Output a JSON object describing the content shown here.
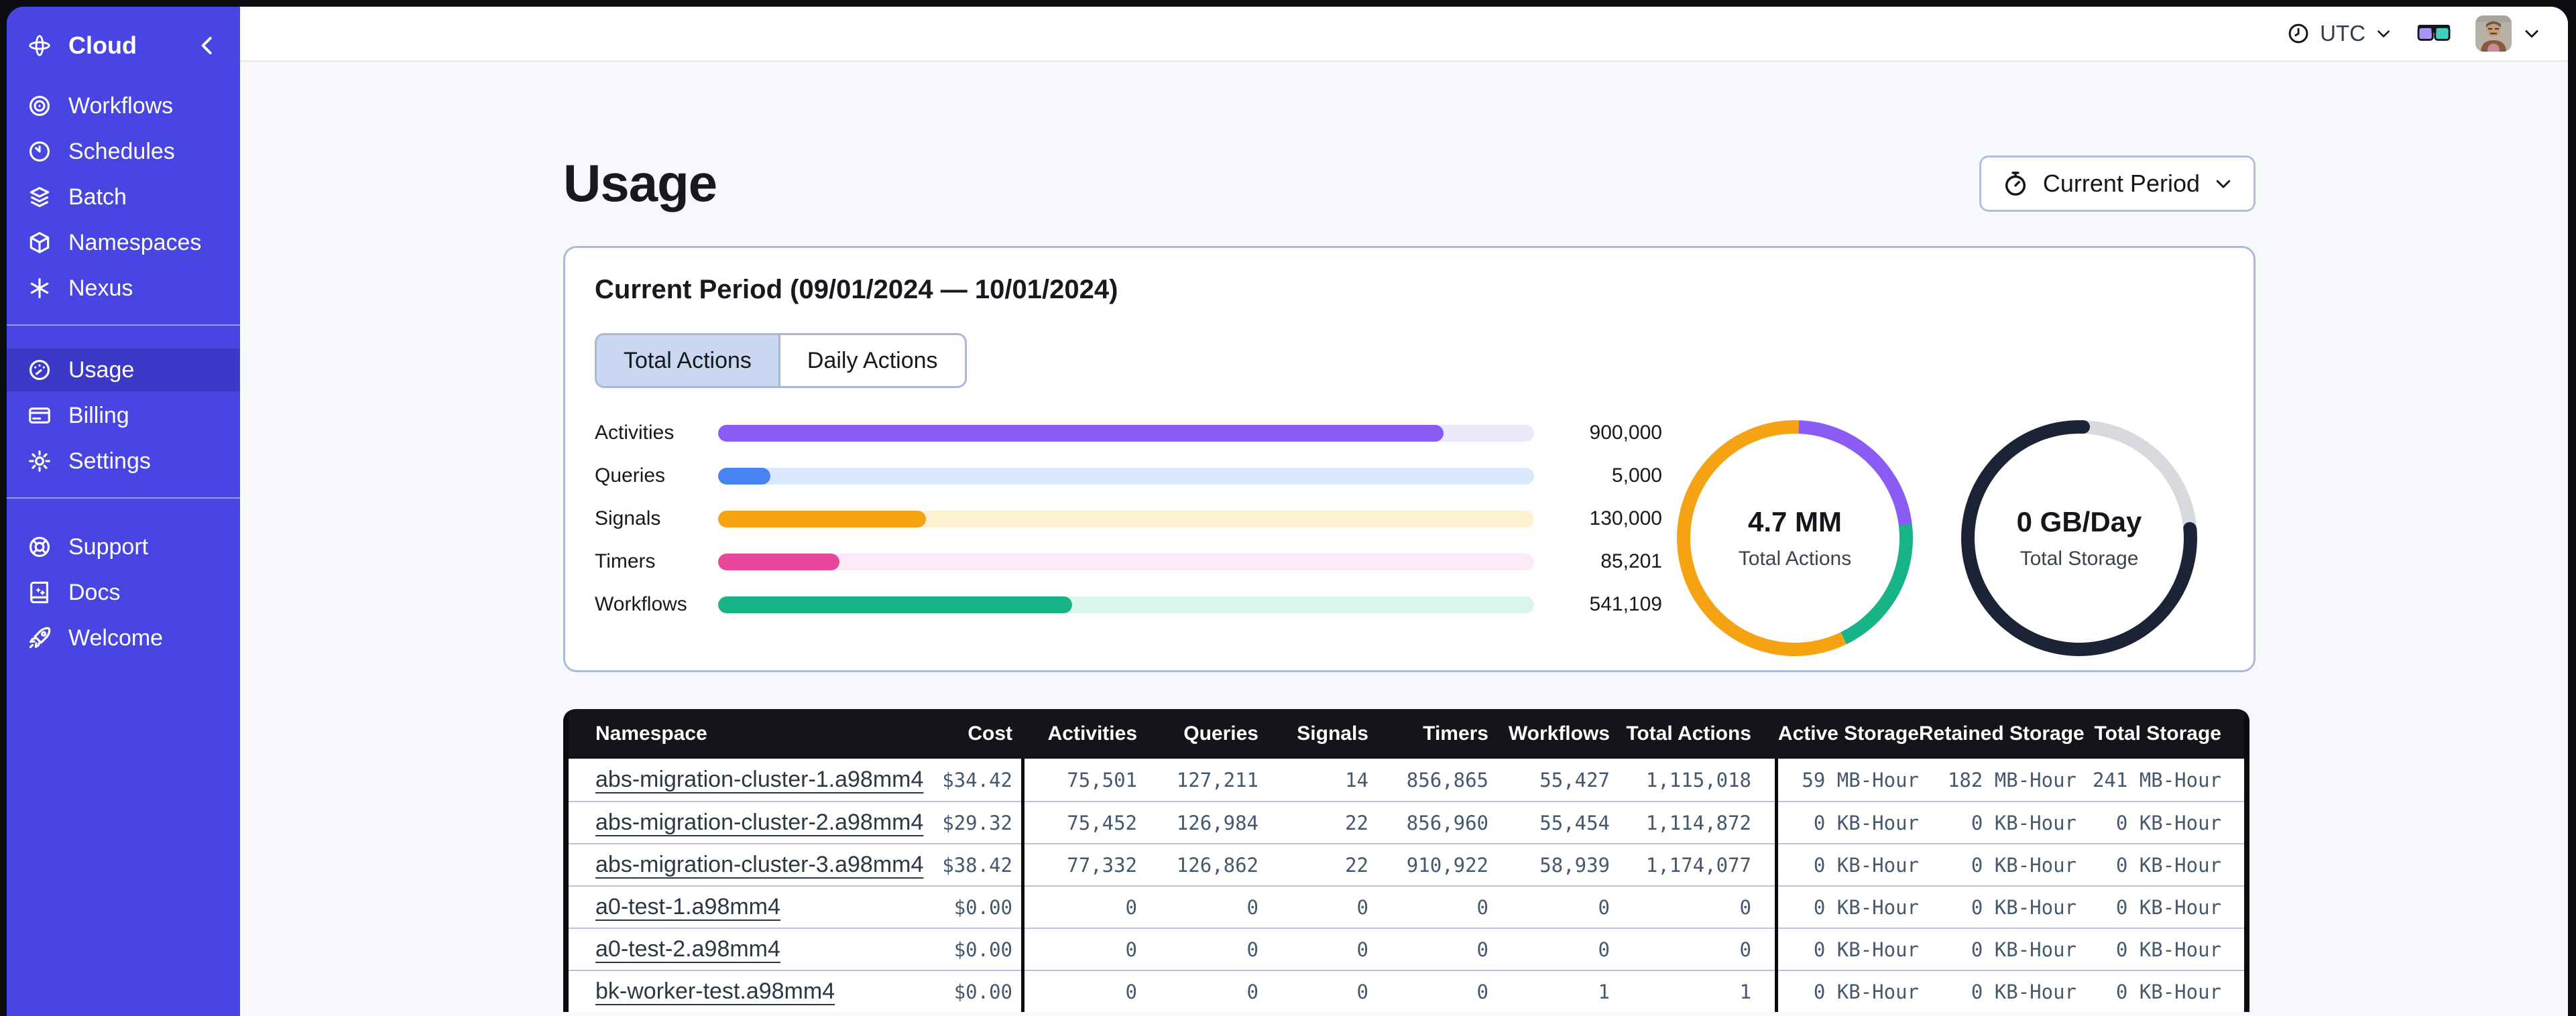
{
  "sidebar": {
    "brand": {
      "label": "Cloud"
    },
    "nav_main": [
      {
        "label": "Workflows"
      },
      {
        "label": "Schedules"
      },
      {
        "label": "Batch"
      },
      {
        "label": "Namespaces"
      },
      {
        "label": "Nexus"
      }
    ],
    "nav_account": [
      {
        "label": "Usage",
        "active": true
      },
      {
        "label": "Billing",
        "active": false
      },
      {
        "label": "Settings",
        "active": false
      }
    ],
    "nav_help": [
      {
        "label": "Support"
      },
      {
        "label": "Docs"
      },
      {
        "label": "Welcome"
      }
    ]
  },
  "topbar": {
    "timezone": "UTC"
  },
  "main": {
    "title": "Usage",
    "period_selector": {
      "label": "Current Period"
    },
    "card": {
      "title": "Current Period (09/01/2024 — 10/01/2024)",
      "tabs": [
        {
          "label": "Total Actions",
          "active": true
        },
        {
          "label": "Daily Actions",
          "active": false
        }
      ]
    }
  },
  "chart_data": [
    {
      "type": "bar",
      "title": "Total Actions by type",
      "categories": [
        "Activities",
        "Queries",
        "Signals",
        "Timers",
        "Workflows"
      ],
      "values": [
        900000,
        5000,
        130000,
        85201,
        541109
      ],
      "value_labels": [
        "900,000",
        "5,000",
        "130,000",
        "85,201",
        "541,109"
      ],
      "fill_fractions": [
        0.889,
        0.064,
        0.255,
        0.149,
        0.434
      ],
      "bar_colors": [
        "#8a5cf5",
        "#4784f2",
        "#f6a313",
        "#e8489b",
        "#16b487"
      ],
      "track_colors": [
        "#ece8fc",
        "#dce8fb",
        "#fcf1d0",
        "#fde9f7",
        "#d9f6ea"
      ],
      "legend_position": "none",
      "grid": false
    },
    {
      "type": "donut",
      "center_value": "4.7 MM",
      "center_label": "Total Actions",
      "start_deg": 2,
      "segments": [
        {
          "name": "activities",
          "color": "#8a5cf5",
          "deg": 81
        },
        {
          "name": "workflows",
          "color": "#16b487",
          "deg": 71
        },
        {
          "name": "signals",
          "color": "#f6a313",
          "deg": 208
        }
      ],
      "round_caps": false
    },
    {
      "type": "donut",
      "center_value": "0 GB/Day",
      "center_label": "Total Storage",
      "start_deg": 85,
      "segments": [
        {
          "name": "storage-used",
          "color": "#1b2436",
          "deg": 277
        },
        {
          "name": "storage-remaining",
          "color": "#d7d9dd",
          "deg": 83
        }
      ],
      "round_caps": true
    }
  ],
  "table": {
    "headers": [
      "Namespace",
      "Cost",
      "Activities",
      "Queries",
      "Signals",
      "Timers",
      "Workflows",
      "Total Actions",
      "Active Storage",
      "Retained Storage",
      "Total Storage"
    ],
    "rows": [
      {
        "cells": [
          "abs-migration-cluster-1.a98mm4",
          "$34.42",
          "75,501",
          "127,211",
          "14",
          "856,865",
          "55,427",
          "1,115,018",
          "59 MB-Hour",
          "182 MB-Hour",
          "241 MB-Hour"
        ]
      },
      {
        "cells": [
          "abs-migration-cluster-2.a98mm4",
          "$29.32",
          "75,452",
          "126,984",
          "22",
          "856,960",
          "55,454",
          "1,114,872",
          "0 KB-Hour",
          "0 KB-Hour",
          "0 KB-Hour"
        ]
      },
      {
        "cells": [
          "abs-migration-cluster-3.a98mm4",
          "$38.42",
          "77,332",
          "126,862",
          "22",
          "910,922",
          "58,939",
          "1,174,077",
          "0 KB-Hour",
          "0 KB-Hour",
          "0 KB-Hour"
        ]
      },
      {
        "cells": [
          "a0-test-1.a98mm4",
          "$0.00",
          "0",
          "0",
          "0",
          "0",
          "0",
          "0",
          "0 KB-Hour",
          "0 KB-Hour",
          "0 KB-Hour"
        ]
      },
      {
        "cells": [
          "a0-test-2.a98mm4",
          "$0.00",
          "0",
          "0",
          "0",
          "0",
          "0",
          "0",
          "0 KB-Hour",
          "0 KB-Hour",
          "0 KB-Hour"
        ]
      },
      {
        "cells": [
          "bk-worker-test.a98mm4",
          "$0.00",
          "0",
          "0",
          "0",
          "0",
          "1",
          "1",
          "0 KB-Hour",
          "0 KB-Hour",
          "0 KB-Hour"
        ]
      }
    ]
  }
}
